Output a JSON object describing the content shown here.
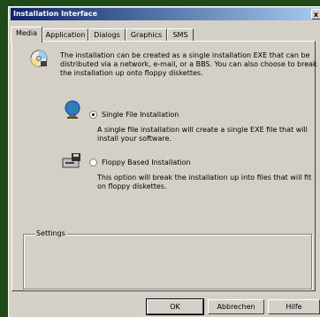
{
  "window": {
    "title": "Installation Interface",
    "close_glyph": "x"
  },
  "tabs": [
    {
      "label": "Media",
      "active": true
    },
    {
      "label": "Application",
      "active": false
    },
    {
      "label": "Dialogs",
      "active": false
    },
    {
      "label": "Graphics",
      "active": false
    },
    {
      "label": "SMS",
      "active": false
    }
  ],
  "intro": {
    "icon": "cd-disc-icon",
    "line1": "The installation can be created as a single installation EXE that can be",
    "line2": "distributed via a network, e-mail, or a BBS. You can also choose to break",
    "line3": "the installation up onto floppy diskettes."
  },
  "option_single": {
    "icon": "globe-icon",
    "label": "Single File Installation",
    "selected": true,
    "desc1": "A single file installation will create a single EXE file that will",
    "desc2": "install your software."
  },
  "option_floppy": {
    "icon": "floppy-drive-icon",
    "label": "Floppy Based Installation",
    "selected": false,
    "desc1": "This option will break the installation up into files that will fit",
    "desc2": "on floppy diskettes."
  },
  "settings_group": {
    "label": "Settings"
  },
  "buttons": {
    "ok": "OK",
    "cancel": "Abbrechen",
    "help": "Hilfe"
  }
}
